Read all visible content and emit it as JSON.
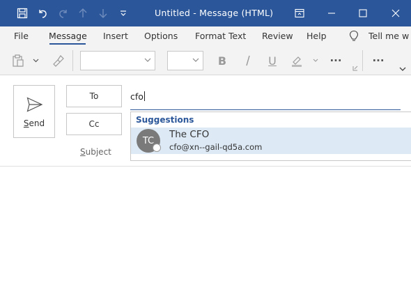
{
  "window": {
    "title": "Untitled  -  Message (HTML)"
  },
  "menu": {
    "tabs": [
      {
        "label": "File"
      },
      {
        "label": "Message"
      },
      {
        "label": "Insert"
      },
      {
        "label": "Options"
      },
      {
        "label": "Format Text"
      },
      {
        "label": "Review"
      },
      {
        "label": "Help"
      }
    ],
    "active_tab": "Message",
    "tell_me": "Tell me w"
  },
  "ribbon": {
    "bold": "B",
    "underline": "U",
    "more": "···"
  },
  "compose": {
    "send_label": "Send",
    "to_label": "To",
    "cc_label": "Cc",
    "subject_label": "Subject",
    "to_value": "cfo"
  },
  "suggestions": {
    "header": "Suggestions",
    "items": [
      {
        "initials": "TC",
        "name": "The CFO",
        "email": "cfo@xn--gail-qd5a.com"
      }
    ]
  },
  "colors": {
    "titlebar": "#2b579a",
    "accent": "#2b579a",
    "suggestion_highlight": "#ddeaf6"
  }
}
